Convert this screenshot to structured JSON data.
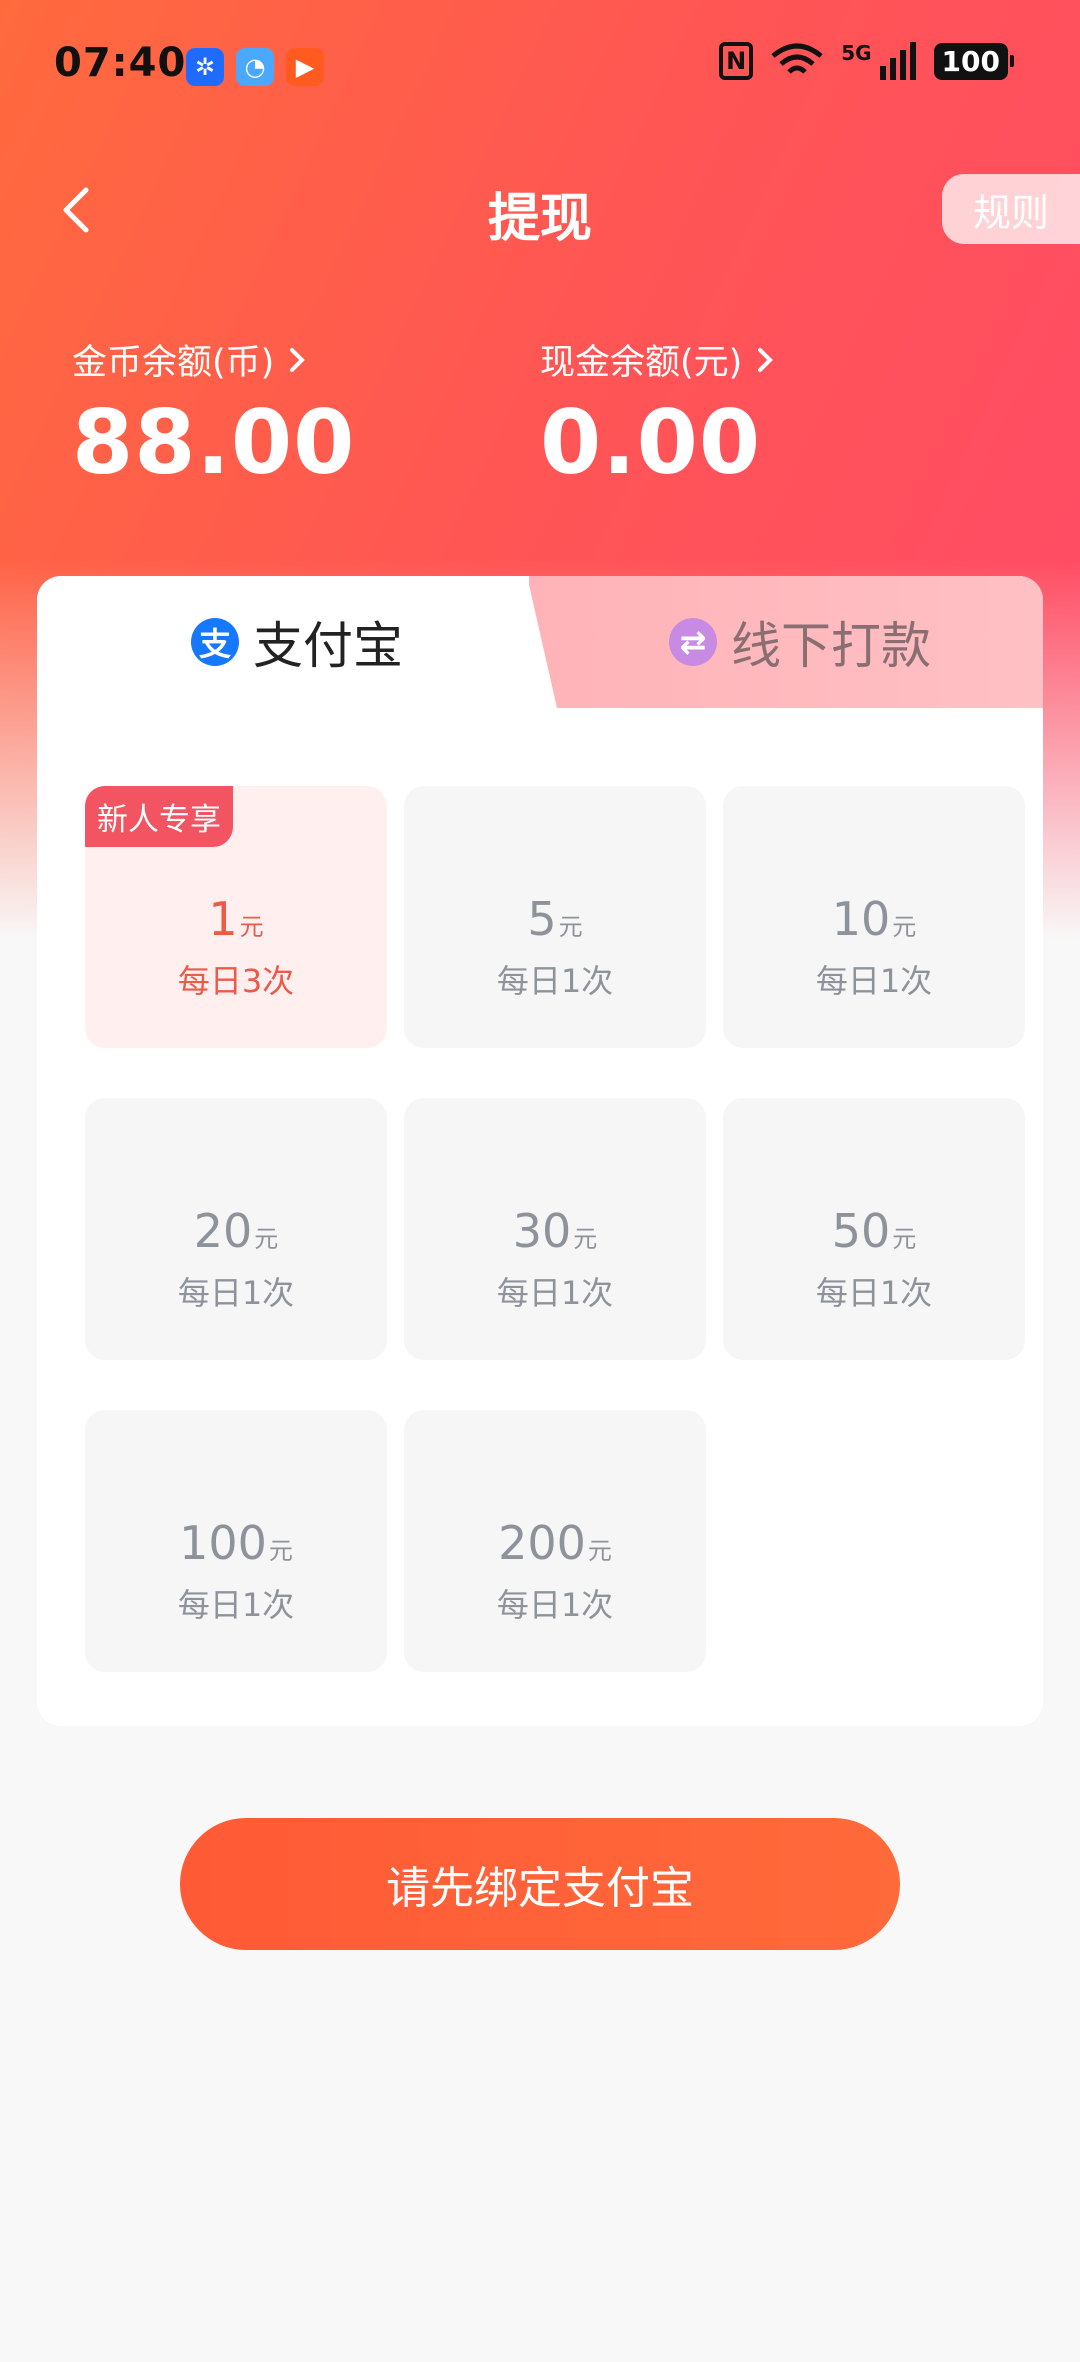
{
  "status_bar": {
    "time": "07:40",
    "network": "5G",
    "battery": "100"
  },
  "header": {
    "title": "提现",
    "rules_label": "规则"
  },
  "balances": {
    "coin_label": "金币余额(币)",
    "coin_value": "88.00",
    "cash_label": "现金余额(元)",
    "cash_value": "0.00"
  },
  "tabs": [
    {
      "label": "支付宝",
      "icon": "alipay-icon",
      "active": true
    },
    {
      "label": "线下打款",
      "icon": "transfer-icon",
      "active": false
    }
  ],
  "amounts": [
    {
      "value": "1",
      "unit": "元",
      "limit": "每日3次",
      "badge": "新人专享",
      "selected": true
    },
    {
      "value": "5",
      "unit": "元",
      "limit": "每日1次"
    },
    {
      "value": "10",
      "unit": "元",
      "limit": "每日1次"
    },
    {
      "value": "20",
      "unit": "元",
      "limit": "每日1次"
    },
    {
      "value": "30",
      "unit": "元",
      "limit": "每日1次"
    },
    {
      "value": "50",
      "unit": "元",
      "limit": "每日1次"
    },
    {
      "value": "100",
      "unit": "元",
      "limit": "每日1次"
    },
    {
      "value": "200",
      "unit": "元",
      "limit": "每日1次"
    }
  ],
  "bind_button": {
    "label": "请先绑定支付宝"
  },
  "colors": {
    "accent": "#ff5a36",
    "selected_text": "#ec5a48",
    "badge": "#f25462"
  }
}
